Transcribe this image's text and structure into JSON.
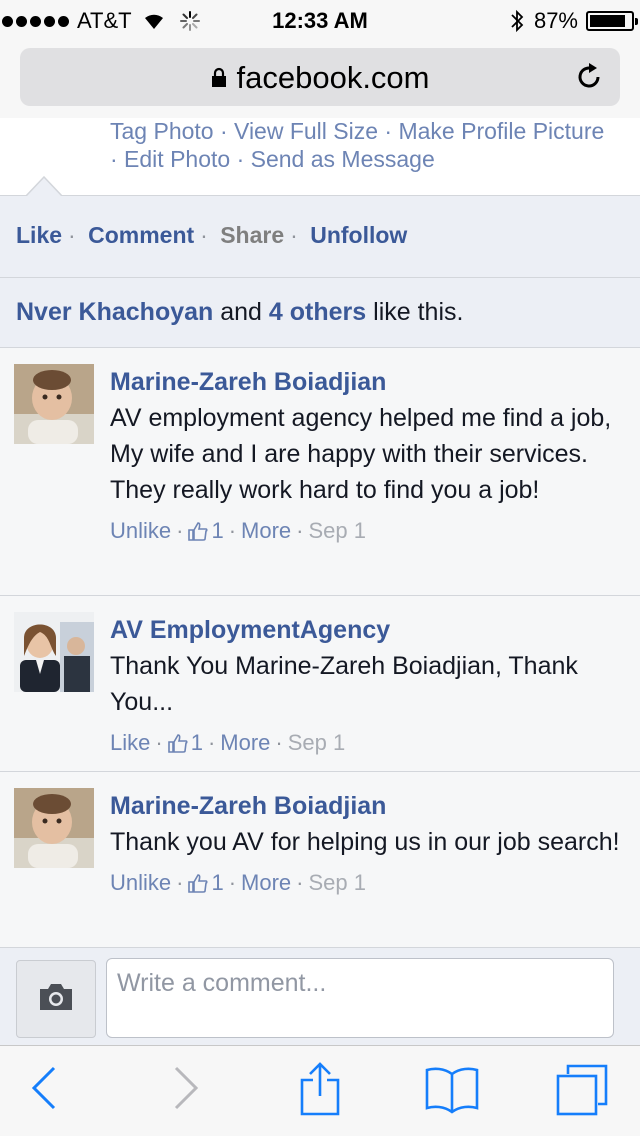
{
  "status_bar": {
    "carrier": "AT&T",
    "time": "12:33 AM",
    "battery": "87%",
    "battery_level": 0.87
  },
  "browser": {
    "url": "facebook.com"
  },
  "photo_actions": {
    "line1": "Tag Photo · View Full Size · Make Profile Picture",
    "line2": "· Edit Photo · Send as Message"
  },
  "post_actions": {
    "like": "Like",
    "comment": "Comment",
    "share": "Share",
    "unfollow": "Unfollow",
    "separator": "·"
  },
  "likes_summary": {
    "name": "Nver Khachoyan",
    "and": "and",
    "others": "4 others",
    "suffix": "like this."
  },
  "comments": [
    {
      "author": "Marine-Zareh Boiadjian",
      "text": "AV employment agency helped me find a job, My wife and I are happy with their services. They really work hard to find you a job!",
      "action": "Unlike",
      "likes": "1",
      "more": "More",
      "date": "Sep 1"
    },
    {
      "author": "AV EmploymentAgency",
      "text": "Thank You Marine-Zareh Boiadjian, Thank You...",
      "action": "Like",
      "likes": "1",
      "more": "More",
      "date": "Sep 1"
    },
    {
      "author": "Marine-Zareh Boiadjian",
      "text": "Thank you AV for helping us in our job search!",
      "action": "Unlike",
      "likes": "1",
      "more": "More",
      "date": "Sep 1"
    }
  ],
  "composer": {
    "placeholder": "Write a comment..."
  },
  "colors": {
    "facebook_blue": "#3b5998",
    "link_blue": "#6d84b4",
    "ios_blue": "#157efb"
  }
}
